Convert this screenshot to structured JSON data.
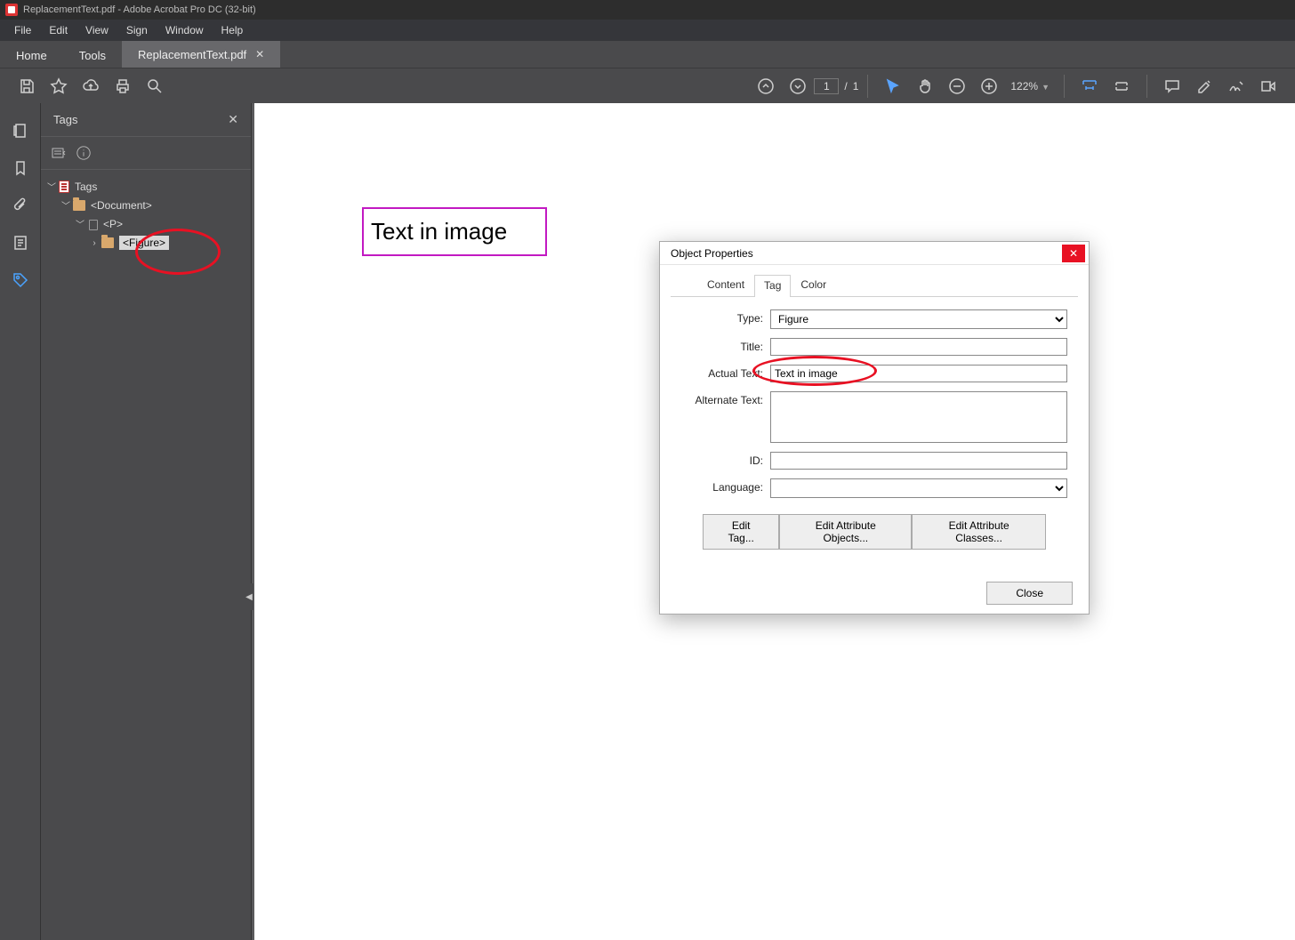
{
  "title": "ReplacementText.pdf - Adobe Acrobat Pro DC (32-bit)",
  "menu": {
    "file": "File",
    "edit": "Edit",
    "view": "View",
    "sign": "Sign",
    "window": "Window",
    "help": "Help"
  },
  "tabs": {
    "home": "Home",
    "tools": "Tools",
    "doc": "ReplacementText.pdf"
  },
  "toolbar": {
    "page_current": "1",
    "page_sep": "/",
    "page_total": "1",
    "zoom": "122%"
  },
  "tags_panel": {
    "title": "Tags",
    "root": "Tags",
    "document": "<Document>",
    "p": "<P>",
    "figure": "<Figure>"
  },
  "page_figure_text": "Text in image",
  "dialog": {
    "title": "Object Properties",
    "tabs": {
      "content": "Content",
      "tag": "Tag",
      "color": "Color"
    },
    "labels": {
      "type": "Type:",
      "title": "Title:",
      "actual": "Actual Text:",
      "alt": "Alternate Text:",
      "id": "ID:",
      "lang": "Language:"
    },
    "values": {
      "type": "Figure",
      "title": "",
      "actual": "Text in image",
      "alt": "",
      "id": "",
      "lang": ""
    },
    "buttons": {
      "edit_tag": "Edit Tag...",
      "edit_attr_obj": "Edit Attribute Objects...",
      "edit_attr_cls": "Edit Attribute Classes...",
      "close": "Close"
    }
  }
}
